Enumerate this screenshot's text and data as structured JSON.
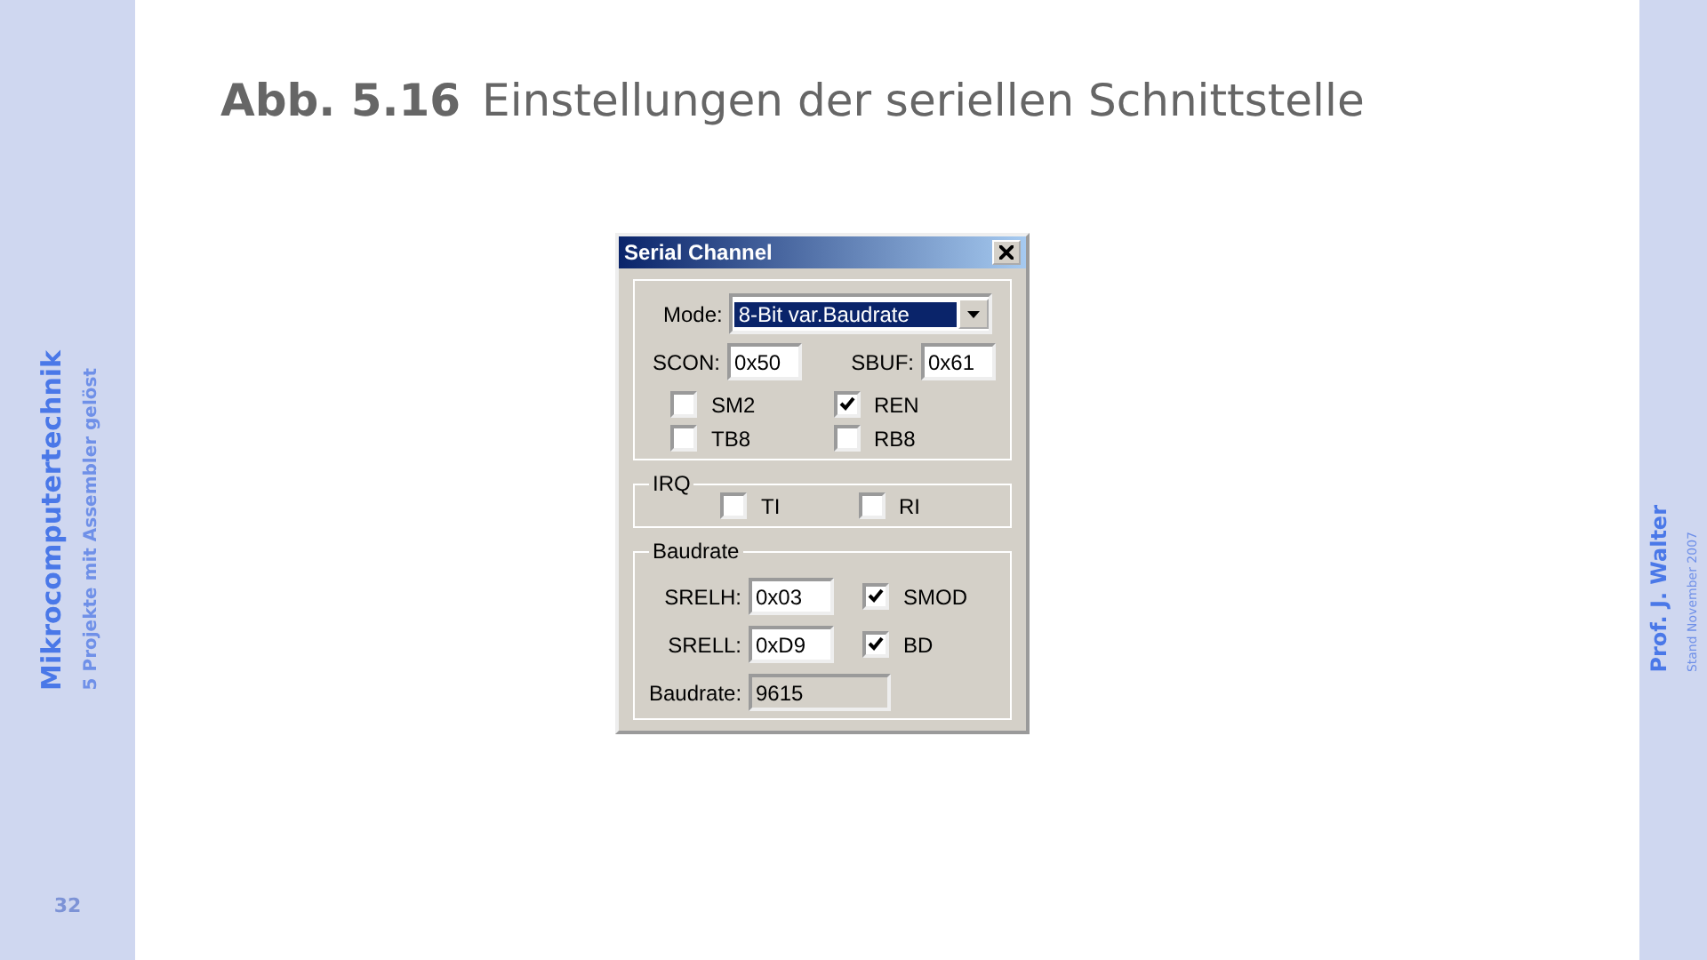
{
  "left_sidebar": {
    "course": "Mikrocomputertechnik",
    "chapter": "5  Projekte mit Assembler gelöst",
    "page": "32"
  },
  "right_sidebar": {
    "author": "Prof. J. Walter",
    "date": "Stand November 2007"
  },
  "heading": {
    "number": "Abb. 5.16",
    "title": "Einstellungen der seriellen Schnittstelle"
  },
  "dialog": {
    "title": "Serial Channel",
    "mode": {
      "label": "Mode:",
      "value": "8-Bit var.Baudrate"
    },
    "registers": [
      {
        "label": "SCON:",
        "value": "0x50"
      },
      {
        "label": "SBUF:",
        "value": "0x61"
      }
    ],
    "flags": [
      {
        "label": "SM2",
        "checked": false
      },
      {
        "label": "REN",
        "checked": true
      },
      {
        "label": "TB8",
        "checked": false
      },
      {
        "label": "RB8",
        "checked": false
      }
    ],
    "irq": {
      "title": "IRQ",
      "flags": [
        {
          "label": "TI",
          "checked": false
        },
        {
          "label": "RI",
          "checked": false
        }
      ]
    },
    "baudrate": {
      "title": "Baudrate",
      "fields": [
        {
          "label": "SRELH:",
          "value": "0x03",
          "readonly": false
        },
        {
          "label": "SRELL:",
          "value": "0xD9",
          "readonly": false
        },
        {
          "label": "Baudrate:",
          "value": "9615",
          "readonly": true
        }
      ],
      "flags": [
        {
          "label": "SMOD",
          "checked": true
        },
        {
          "label": "BD",
          "checked": true
        }
      ]
    }
  }
}
